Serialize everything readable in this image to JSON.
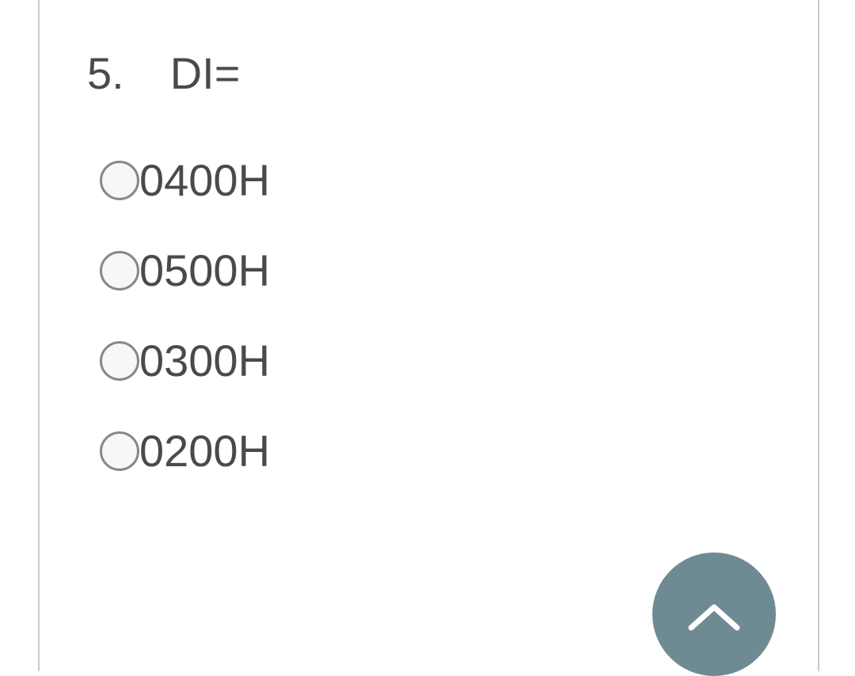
{
  "question": {
    "number": "5.",
    "text": "DI=",
    "options": [
      {
        "label": "0400H"
      },
      {
        "label": "0500H"
      },
      {
        "label": "0300H"
      },
      {
        "label": "0200H"
      }
    ]
  },
  "colors": {
    "button_bg": "#6e8a92",
    "text": "#4a4a4a",
    "border": "#c9c9c9",
    "radio_border": "#888888"
  }
}
